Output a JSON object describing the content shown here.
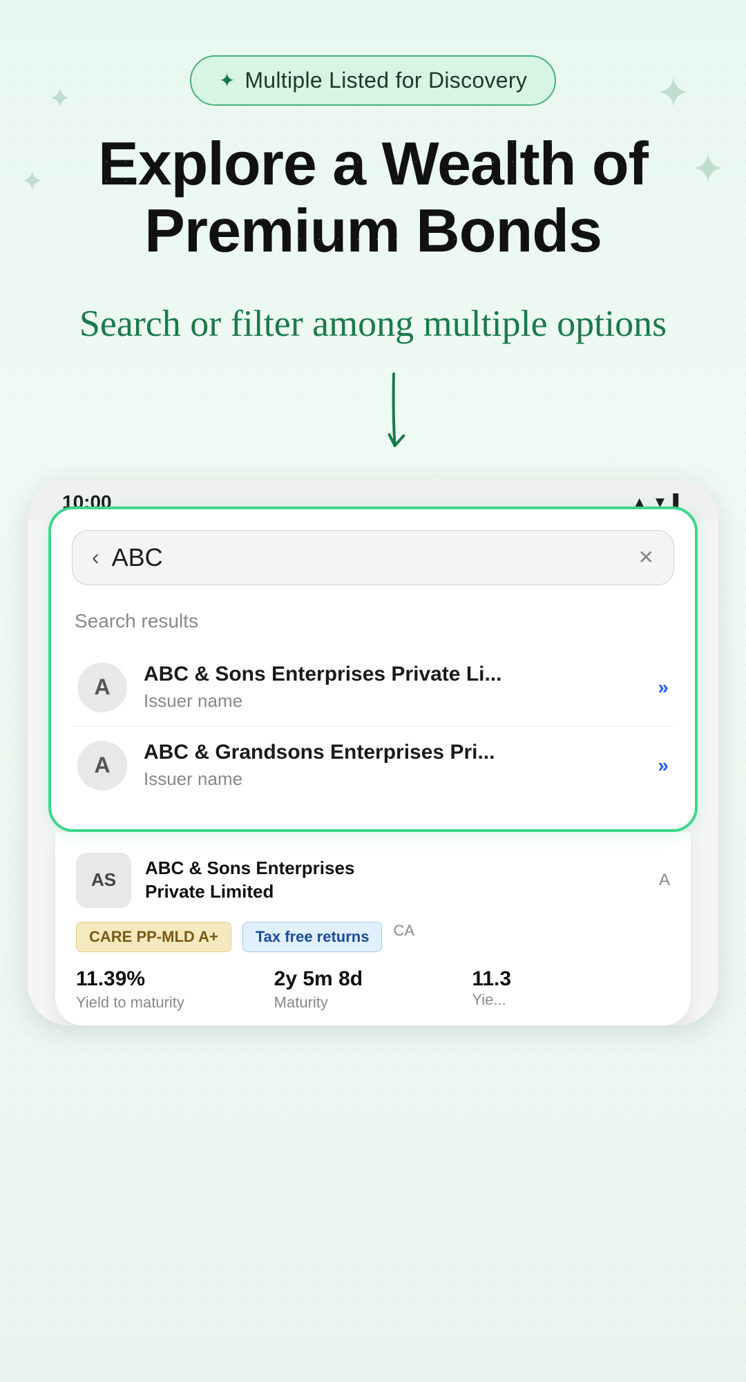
{
  "badge": {
    "icon": "✦",
    "label": "Multiple Listed for Discovery"
  },
  "heading": {
    "line1": "Explore a Wealth of",
    "line2": "Premium Bonds"
  },
  "subtitle": "Search or filter among multiple options",
  "phone": {
    "status_time": "10:00",
    "search_query": "ABC",
    "search_results_label": "Search results",
    "results": [
      {
        "avatar": "A",
        "name": "ABC & Sons Enterprises Private Li...",
        "subtext": "Issuer name"
      },
      {
        "avatar": "A",
        "name": "ABC & Grandsons Enterprises Pri...",
        "subtext": "Issuer name"
      }
    ],
    "bond_card": {
      "avatar": "AS",
      "company_name_line1": "ABC & Sons Enterprises",
      "company_name_line2": "Private Limited",
      "tag_rating": "CARE PP-MLD A+",
      "tag_tax": "Tax free returns",
      "yield_value": "11.39%",
      "yield_label": "Yield to maturity",
      "maturity_value": "2y 5m 8d",
      "maturity_label": "Maturity",
      "yield2_value": "11.3",
      "yield2_label": "Yie..."
    }
  }
}
